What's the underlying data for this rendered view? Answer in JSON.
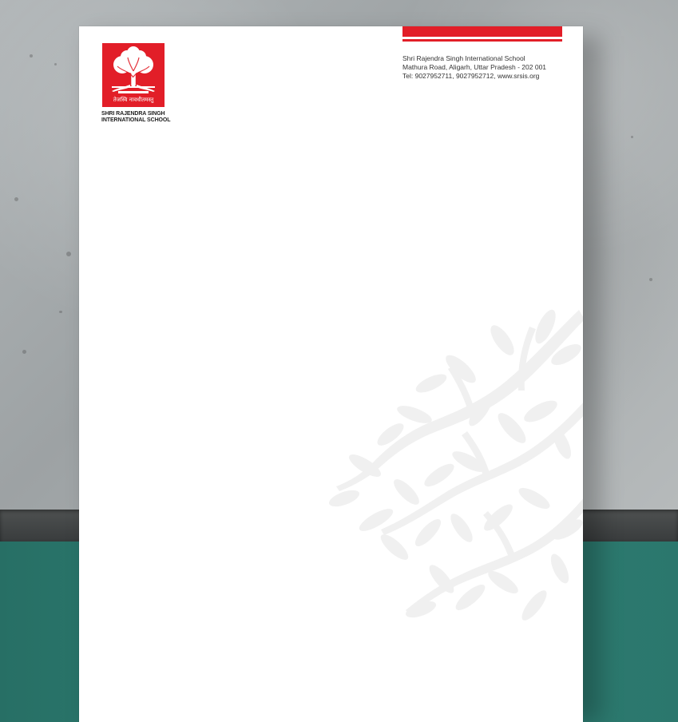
{
  "scene": {
    "description_label": "letterhead mockup on concrete wall"
  },
  "letterhead": {
    "accent_color": "#e21e28",
    "school_name": "Shri Rajendra Singh International School",
    "address_line": "Mathura Road, Aligarh,  Uttar Pradesh - 202 001",
    "contact_line": "Tel: 9027952711, 9027952712, www.srsis.org",
    "logo": {
      "motto": "तेजस्वि नावधीतमस्तु",
      "name_line_1": "SHRI RAJENDRA SINGH",
      "name_line_2": "INTERNATIONAL SCHOOL"
    }
  }
}
